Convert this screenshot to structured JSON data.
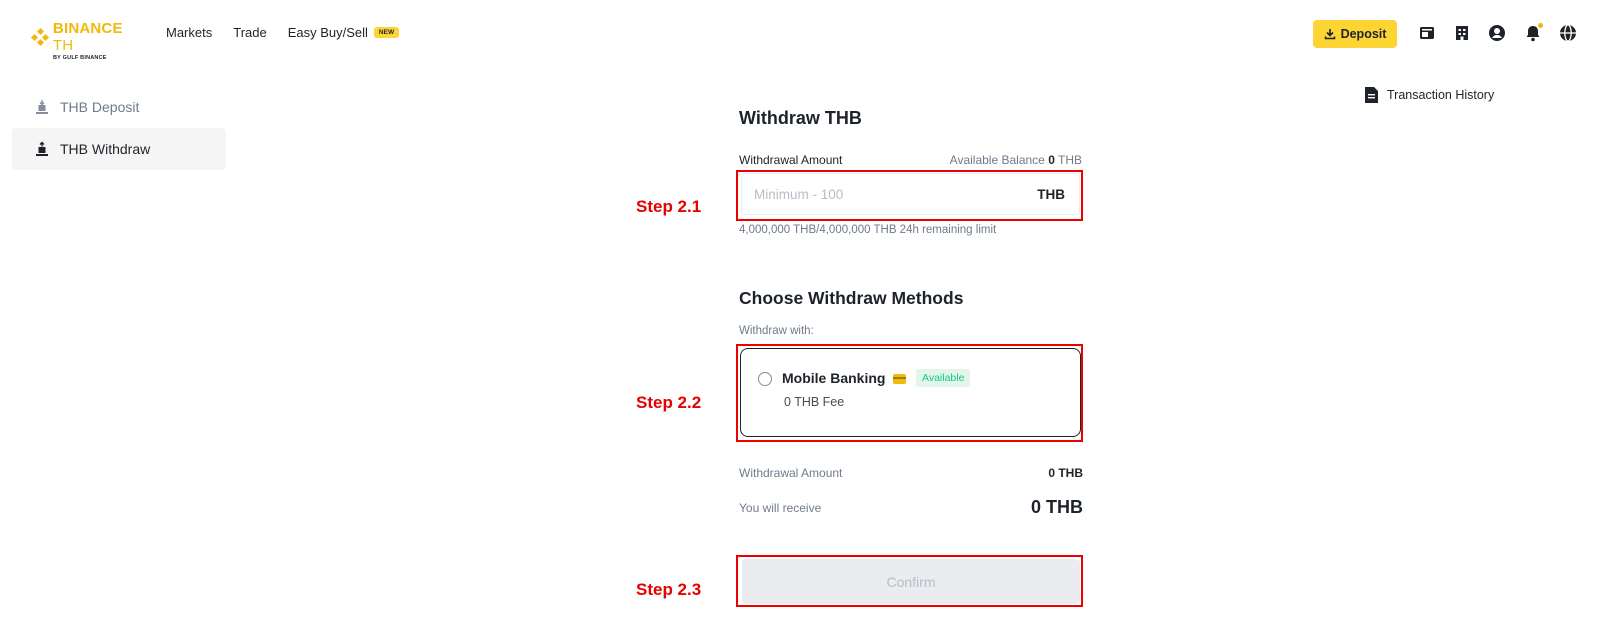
{
  "header": {
    "logo_text": "BINANCE",
    "logo_suffix": "TH",
    "logo_sub": "BY GULF BINANCE",
    "nav": [
      {
        "label": "Markets"
      },
      {
        "label": "Trade"
      },
      {
        "label": "Easy Buy/Sell",
        "badge": "NEW"
      }
    ],
    "deposit_label": "Deposit",
    "icons": [
      "wallet-icon",
      "orders-icon",
      "user-icon",
      "bell-icon",
      "globe-icon"
    ],
    "accent_color": "#fcd535"
  },
  "sidebar": {
    "items": [
      {
        "label": "THB Deposit",
        "active": false
      },
      {
        "label": "THB Withdraw",
        "active": true
      }
    ]
  },
  "transaction_history_label": "Transaction History",
  "withdraw": {
    "title": "Withdraw THB",
    "amount_label": "Withdrawal Amount",
    "balance_label": "Available Balance",
    "balance_value": "0",
    "balance_currency": "THB",
    "amount_placeholder": "Minimum - 100",
    "amount_currency": "THB",
    "limit_text": "4,000,000 THB/4,000,000 THB 24h remaining limit"
  },
  "methods": {
    "title": "Choose Withdraw Methods",
    "with_label": "Withdraw with:",
    "items": [
      {
        "name": "Mobile Banking",
        "status": "Available",
        "fee": "0 THB Fee"
      }
    ]
  },
  "summary": {
    "amount_label": "Withdrawal Amount",
    "amount_value": "0 THB",
    "receive_label": "You will receive",
    "receive_value": "0 THB"
  },
  "confirm_label": "Confirm",
  "annotations": [
    {
      "label": "Step 2.1"
    },
    {
      "label": "Step 2.2"
    },
    {
      "label": "Step 2.3"
    }
  ],
  "annotation_color": "#ee0000"
}
